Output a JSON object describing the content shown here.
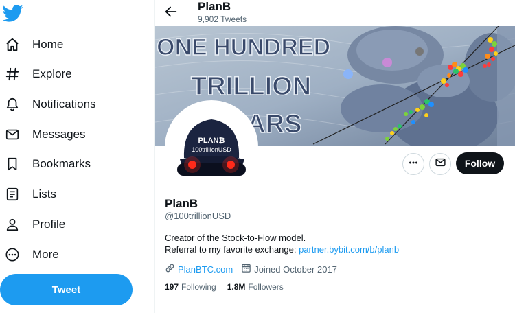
{
  "sidebar": {
    "logo": "twitter-bird-icon",
    "items": [
      {
        "label": "Home",
        "icon": "home-icon"
      },
      {
        "label": "Explore",
        "icon": "hashtag-icon"
      },
      {
        "label": "Notifications",
        "icon": "bell-icon"
      },
      {
        "label": "Messages",
        "icon": "envelope-icon"
      },
      {
        "label": "Bookmarks",
        "icon": "bookmark-icon"
      },
      {
        "label": "Lists",
        "icon": "list-icon"
      },
      {
        "label": "Profile",
        "icon": "person-icon"
      },
      {
        "label": "More",
        "icon": "more-circle-icon"
      }
    ],
    "tweet_label": "Tweet"
  },
  "header": {
    "name": "PlanB",
    "tweet_count": "9,902 Tweets"
  },
  "banner": {
    "text_line1": "ONE HUNDRED",
    "text_line2": "TRILLION",
    "text_line3": "LARS"
  },
  "avatar": {
    "cap_text1": "PLAN₿",
    "cap_text2": "100trillionUSD"
  },
  "actions": {
    "more_icon": "more-horizontal-icon",
    "message_icon": "envelope-icon",
    "follow_label": "Follow"
  },
  "profile": {
    "display_name": "PlanB",
    "handle": "@100trillionUSD",
    "bio_line1": "Creator of the Stock-to-Flow model.",
    "bio_line2_prefix": "Referral to my favorite exchange: ",
    "bio_link": "partner.bybit.com/b/planb",
    "website": "PlanBTC.com",
    "joined": "Joined October 2017",
    "following_count": "197",
    "following_label": "Following",
    "followers_count": "1.8M",
    "followers_label": "Followers"
  },
  "colors": {
    "accent": "#1d9bf0",
    "follow_bg": "#0f1419"
  }
}
